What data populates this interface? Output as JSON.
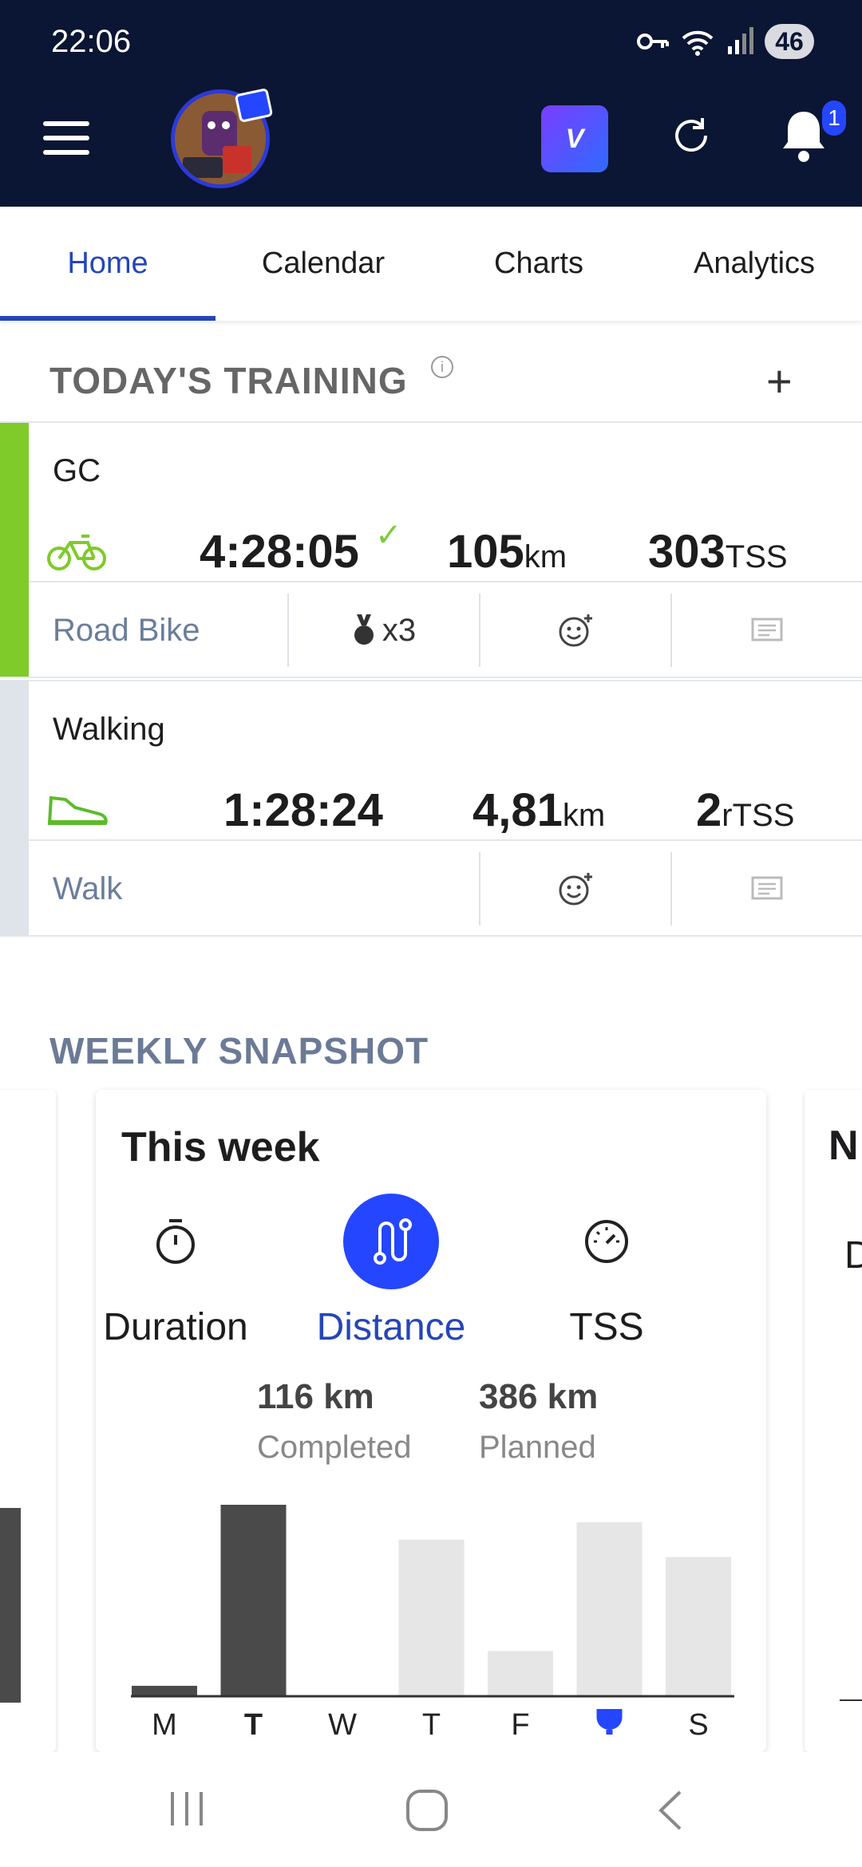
{
  "status": {
    "time": "22:06",
    "battery": "46"
  },
  "header": {
    "notification_count": "1",
    "app_logo_text": "V"
  },
  "tabs": [
    {
      "label": "Home",
      "active": true
    },
    {
      "label": "Calendar"
    },
    {
      "label": "Charts"
    },
    {
      "label": "Analytics"
    }
  ],
  "today": {
    "title": "TODAY'S TRAINING",
    "workouts": [
      {
        "name": "GC",
        "icon": "bike-icon",
        "duration": "4:28:05",
        "completed": true,
        "distance": "105",
        "distance_unit": "km",
        "load": "303",
        "load_unit": "TSS",
        "type_label": "Road Bike",
        "medals": "x3",
        "color": "#7ecb2a"
      },
      {
        "name": "Walking",
        "icon": "shoe-icon",
        "duration": "1:28:24",
        "distance": "4,81",
        "distance_unit": "km",
        "load": "2",
        "load_unit": "rTSS",
        "type_label": "Walk",
        "color": "#dfe3ea"
      }
    ]
  },
  "weekly": {
    "title": "WEEKLY SNAPSHOT",
    "card_title": "This week",
    "metrics": [
      {
        "label": "Duration",
        "icon": "stopwatch-icon"
      },
      {
        "label": "Distance",
        "icon": "route-icon",
        "active": true
      },
      {
        "label": "TSS",
        "icon": "gauge-icon"
      }
    ],
    "completed_value": "116 km",
    "completed_label": "Completed",
    "planned_value": "386 km",
    "planned_label": "Planned"
  },
  "chart_data": {
    "type": "bar",
    "categories": [
      "M",
      "T",
      "W",
      "T",
      "F",
      "🏆",
      "S"
    ],
    "series": [
      {
        "name": "",
        "values": [
          6,
          110,
          0,
          0,
          0,
          0,
          0
        ]
      },
      {
        "name": "",
        "values": [
          6,
          110,
          0,
          90,
          26,
          100,
          80
        ]
      }
    ],
    "ylim": [
      0,
      110
    ],
    "today_index": 1,
    "trophy_index": 5
  },
  "colors": {
    "accent": "#2546ff",
    "header": "#0b1534",
    "completed_bar": "#4a4a4a",
    "planned_bar": "#e6e6e6"
  }
}
